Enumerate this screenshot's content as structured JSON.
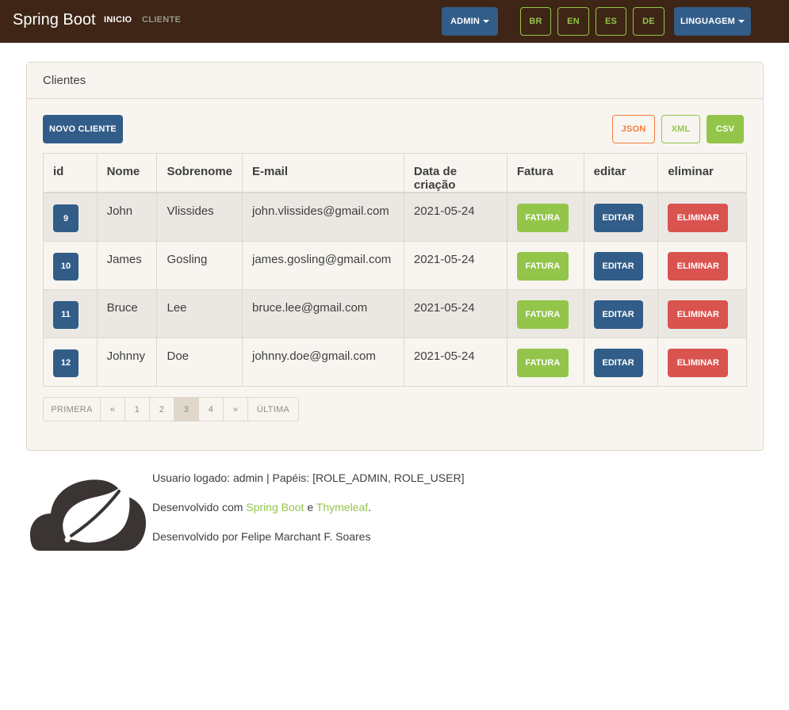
{
  "navbar": {
    "brand": "Spring Boot",
    "links": [
      "INICIO",
      "CLIENTE"
    ],
    "admin_label": "ADMIN",
    "langs": [
      "BR",
      "EN",
      "ES",
      "DE"
    ],
    "language_label": "LINGUAGEM"
  },
  "card": {
    "header": "Clientes",
    "new_button": "NOVO CLIENTE",
    "export": [
      "JSON",
      "XML",
      "CSV"
    ]
  },
  "table": {
    "columns": [
      "id",
      "Nome",
      "Sobrenome",
      "E-mail",
      "Data de criação",
      "Fatura",
      "editar",
      "eliminar"
    ],
    "rows": [
      {
        "id": "9",
        "nome": "John",
        "sobrenome": "Vlissides",
        "email": "john.vlissides@gmail.com",
        "data": "2021-05-24"
      },
      {
        "id": "10",
        "nome": "James",
        "sobrenome": "Gosling",
        "email": "james.gosling@gmail.com",
        "data": "2021-05-24"
      },
      {
        "id": "11",
        "nome": "Bruce",
        "sobrenome": "Lee",
        "email": "bruce.lee@gmail.com",
        "data": "2021-05-24"
      },
      {
        "id": "12",
        "nome": "Johnny",
        "sobrenome": "Doe",
        "email": "johnny.doe@gmail.com",
        "data": "2021-05-24"
      }
    ],
    "fatura_label": "FATURA",
    "editar_label": "EDITAR",
    "eliminar_label": "ELIMINAR"
  },
  "pagination": {
    "items": [
      "PRIMERA",
      "«",
      "1",
      "2",
      "3",
      "4",
      "»",
      "ÚLTIMA"
    ],
    "active": "3"
  },
  "footer": {
    "user_line": "Usuario logado: admin | Papéis: [ROLE_ADMIN, ROLE_USER]",
    "dev_prefix": "Desenvolvido com",
    "link1": "Spring Boot",
    "conj": "e",
    "link2": "Thymeleaf",
    "dev_suffix": ".",
    "author_line": "Desenvolvido por Felipe Marchant F. Soares"
  },
  "colors": {
    "navbar_bg": "#3e2515",
    "primary": "#325d88",
    "success": "#93c54b",
    "danger": "#d9534f",
    "warning": "#f47c3c",
    "card_bg": "#f8f5f0"
  },
  "icons": {
    "logo": "spring-leaf-cloud-logo"
  }
}
